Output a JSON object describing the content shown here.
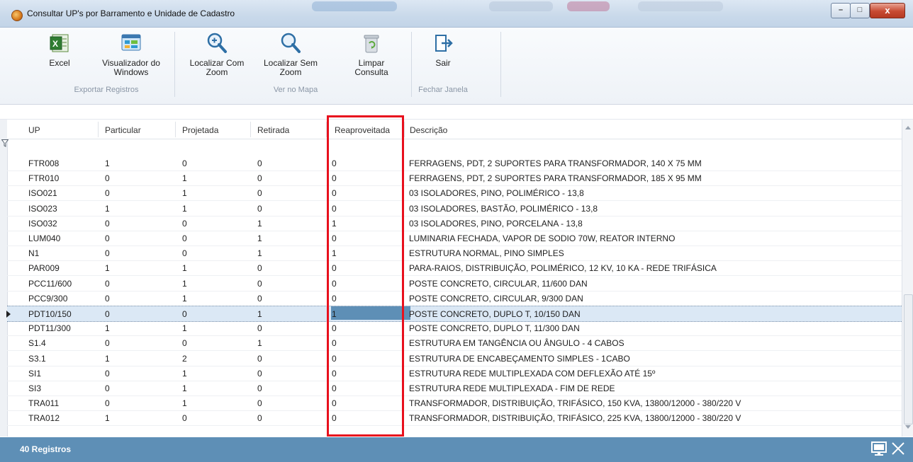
{
  "window": {
    "title": "Consultar UP's por Barramento e Unidade de Cadastro",
    "minimize_glyph": "–",
    "maximize_glyph": "□",
    "close_glyph": "x"
  },
  "ribbon": {
    "buttons": [
      {
        "label": "Excel",
        "icon": "excel-icon"
      },
      {
        "label": "Visualizador do Windows",
        "icon": "windows-viewer-icon"
      },
      {
        "label": "Localizar Com Zoom",
        "icon": "map-zoom-icon"
      },
      {
        "label": "Localizar Sem Zoom",
        "icon": "map-locate-icon"
      },
      {
        "label": "Limpar Consulta",
        "icon": "trash-icon"
      },
      {
        "label": "Sair",
        "icon": "exit-icon"
      }
    ],
    "groups": [
      "Exportar Registros",
      "Ver no Mapa",
      "Fechar Janela"
    ]
  },
  "grid": {
    "columns": [
      "UP",
      "Particular",
      "Projetada",
      "Retirada",
      "Reaproveitada",
      "Descrição"
    ],
    "rows": [
      [
        "FTR008",
        "1",
        "0",
        "0",
        "0",
        "FERRAGENS, PDT, 2 SUPORTES PARA TRANSFORMADOR, 140 X 75 MM"
      ],
      [
        "FTR010",
        "0",
        "1",
        "0",
        "0",
        "FERRAGENS, PDT, 2 SUPORTES PARA TRANSFORMADOR, 185 X 95 MM"
      ],
      [
        "ISO021",
        "0",
        "1",
        "0",
        "0",
        "03 ISOLADORES, PINO, POLIMÉRICO - 13,8"
      ],
      [
        "ISO023",
        "1",
        "1",
        "0",
        "0",
        "03 ISOLADORES, BASTÃO, POLIMÉRICO - 13,8"
      ],
      [
        "ISO032",
        "0",
        "0",
        "1",
        "1",
        "03 ISOLADORES, PINO, PORCELANA - 13,8"
      ],
      [
        "LUM040",
        "0",
        "0",
        "1",
        "0",
        "LUMINARIA FECHADA, VAPOR DE SODIO 70W, REATOR INTERNO"
      ],
      [
        "N1",
        "0",
        "0",
        "1",
        "1",
        "ESTRUTURA NORMAL, PINO SIMPLES"
      ],
      [
        "PAR009",
        "1",
        "1",
        "0",
        "0",
        "PARA-RAIOS, DISTRIBUIÇÃO, POLIMÉRICO, 12 KV, 10 KA - REDE TRIFÁSICA"
      ],
      [
        "PCC11/600",
        "0",
        "1",
        "0",
        "0",
        "POSTE CONCRETO, CIRCULAR, 11/600 DAN"
      ],
      [
        "PCC9/300",
        "0",
        "1",
        "0",
        "0",
        "POSTE CONCRETO, CIRCULAR, 9/300 DAN"
      ],
      [
        "PDT10/150",
        "0",
        "0",
        "1",
        "1",
        "POSTE CONCRETO, DUPLO T, 10/150 DAN"
      ],
      [
        "PDT11/300",
        "1",
        "1",
        "0",
        "0",
        "POSTE CONCRETO, DUPLO T, 11/300 DAN"
      ],
      [
        "S1.4",
        "0",
        "0",
        "1",
        "0",
        "ESTRUTURA EM TANGÊNCIA OU ÂNGULO - 4 CABOS"
      ],
      [
        "S3.1",
        "1",
        "2",
        "0",
        "0",
        "ESTRUTURA DE ENCABEÇAMENTO SIMPLES - 1CABO"
      ],
      [
        "SI1",
        "0",
        "1",
        "0",
        "0",
        "ESTRUTURA REDE MULTIPLEXADA COM DEFLEXÃO ATÉ 15º"
      ],
      [
        "SI3",
        "0",
        "1",
        "0",
        "0",
        "ESTRUTURA REDE MULTIPLEXADA - FIM DE REDE"
      ],
      [
        "TRA011",
        "0",
        "1",
        "0",
        "0",
        "TRANSFORMADOR, DISTRIBUIÇÃO, TRIFÁSICO, 150 KVA, 13800/12000 - 380/220 V"
      ],
      [
        "TRA012",
        "1",
        "0",
        "0",
        "0",
        "TRANSFORMADOR, DISTRIBUIÇÃO, TRIFÁSICO, 225 KVA, 13800/12000 - 380/220 V"
      ]
    ],
    "selected_row_index": 10,
    "highlighted_column": "Reaproveitada"
  },
  "status": {
    "records": "40 Registros"
  },
  "colors": {
    "status_bar": "#5e8fb6",
    "highlight_border": "#e8101d",
    "selected_row": "#dbe8f5"
  }
}
